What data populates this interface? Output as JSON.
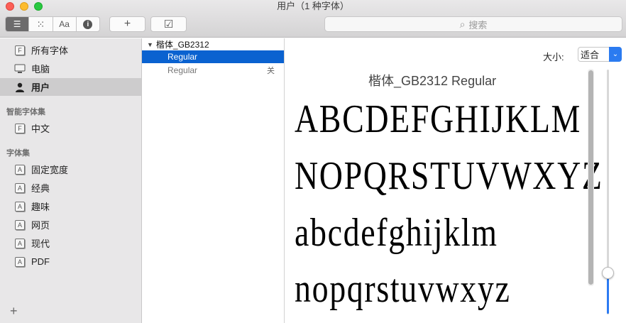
{
  "window": {
    "title": "用户（1 种字体）"
  },
  "toolbar": {
    "view_buttons": [
      {
        "icon": "list-icon",
        "glyph": "☰"
      },
      {
        "icon": "grid-icon",
        "glyph": "⁙"
      },
      {
        "icon": "sample-text-icon",
        "glyph": "Aa"
      },
      {
        "icon": "info-icon",
        "glyph": "i"
      }
    ],
    "add_glyph": "+",
    "validate_glyph": "☑",
    "search_placeholder": "搜索",
    "search_icon": "⌕"
  },
  "sidebar": {
    "library_items": [
      {
        "label": "所有字体",
        "icon": "font-box-icon"
      },
      {
        "label": "电脑",
        "icon": "computer-icon"
      },
      {
        "label": "用户",
        "icon": "user-icon",
        "selected": true
      }
    ],
    "smart_header": "智能字体集",
    "smart_items": [
      {
        "label": "中文",
        "icon": "font-box-icon"
      }
    ],
    "collections_header": "字体集",
    "collections": [
      {
        "label": "固定宽度"
      },
      {
        "label": "经典"
      },
      {
        "label": "趣味"
      },
      {
        "label": "网页"
      },
      {
        "label": "现代"
      },
      {
        "label": "PDF"
      }
    ],
    "add_glyph": "+"
  },
  "font_list": {
    "family": "楷体_GB2312",
    "faces": [
      {
        "name": "Regular",
        "selected": true,
        "status": ""
      },
      {
        "name": "Regular",
        "selected": false,
        "status": "关"
      }
    ]
  },
  "preview": {
    "size_label": "大小:",
    "size_value": "适合",
    "title": "楷体_GB2312 Regular",
    "lines": [
      "ABCDEFGHIJKLM",
      "NOPQRSTUVWXYZ",
      "abcdefghijklm",
      "nopqrstuvwxyz"
    ],
    "size_slider_level": 0.17
  },
  "colors": {
    "selection": "#0a62d0",
    "accent": "#2b7bf0"
  }
}
